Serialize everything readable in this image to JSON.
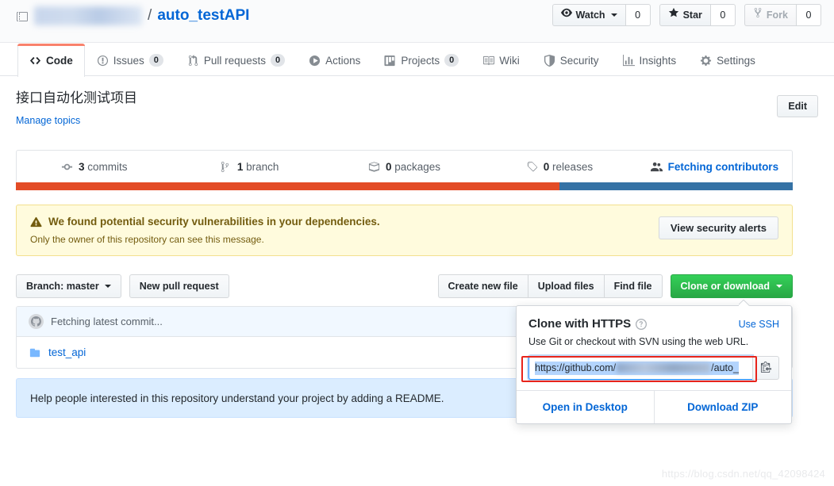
{
  "header": {
    "repo_icon": "repo-book-icon",
    "owner": "redacted-owner",
    "separator": "/",
    "name": "auto_testAPI",
    "watch": {
      "label": "Watch",
      "count": "0",
      "icon": "eye-icon"
    },
    "star": {
      "label": "Star",
      "count": "0",
      "icon": "star-icon"
    },
    "fork": {
      "label": "Fork",
      "count": "0",
      "icon": "fork-icon",
      "disabled": true
    }
  },
  "nav": {
    "items": [
      {
        "label": "Code",
        "icon": "code-icon",
        "count": "",
        "active": true
      },
      {
        "label": "Issues",
        "icon": "issue-opened-icon",
        "count": "0",
        "active": false
      },
      {
        "label": "Pull requests",
        "icon": "git-pull-request-icon",
        "count": "0",
        "active": false
      },
      {
        "label": "Actions",
        "icon": "play-icon",
        "count": "",
        "active": false
      },
      {
        "label": "Projects",
        "icon": "project-board-icon",
        "count": "0",
        "active": false
      },
      {
        "label": "Wiki",
        "icon": "book-icon",
        "count": "",
        "active": false
      },
      {
        "label": "Security",
        "icon": "shield-icon",
        "count": "",
        "active": false
      },
      {
        "label": "Insights",
        "icon": "graph-icon",
        "count": "",
        "active": false
      },
      {
        "label": "Settings",
        "icon": "gear-icon",
        "count": "",
        "active": false
      }
    ]
  },
  "about": {
    "description": "接口自动化测试项目",
    "manage_topics": "Manage topics",
    "edit_label": "Edit"
  },
  "stats": {
    "items": [
      {
        "icon": "commit-icon",
        "value": "3",
        "label": "commits"
      },
      {
        "icon": "branch-icon",
        "value": "1",
        "label": "branch"
      },
      {
        "icon": "package-icon",
        "value": "0",
        "label": "packages"
      },
      {
        "icon": "tag-icon",
        "value": "0",
        "label": "releases"
      }
    ],
    "contributors": {
      "icon": "people-icon",
      "label": "Fetching contributors"
    },
    "languages": [
      {
        "name": "language-primary",
        "color": "#e34c26",
        "percent": 70
      },
      {
        "name": "language-secondary",
        "color": "#3572A5",
        "percent": 30
      }
    ]
  },
  "alert": {
    "icon": "alert-triangle-icon",
    "title": "We found potential security vulnerabilities in your dependencies.",
    "subtitle": "Only the owner of this repository can see this message.",
    "button": "View security alerts",
    "bg_color": "#fffbdd",
    "border_color": "#f3e08e",
    "text_color": "#735c0f"
  },
  "actions": {
    "branch_label": "Branch: master",
    "new_pull_request": "New pull request",
    "create_new_file": "Create new file",
    "upload_files": "Upload files",
    "find_file": "Find file",
    "clone_or_download": "Clone or download",
    "clone_button_color": "#28a745"
  },
  "files": {
    "commit_status": "Fetching latest commit...",
    "rows": [
      {
        "icon": "folder-icon",
        "name": "test_api"
      }
    ]
  },
  "readme_prompt": {
    "text": "Help people interested in this repository understand your project by adding a README."
  },
  "clone_popover": {
    "title": "Clone with HTTPS",
    "help_icon": "question-icon",
    "use_ssh": "Use SSH",
    "description": "Use Git or checkout with SVN using the web URL.",
    "url_prefix": "https://github.com/",
    "url_suffix": "/auto_",
    "copy_icon": "clipboard-copy-icon",
    "open_in_desktop": "Open in Desktop",
    "download_zip": "Download ZIP",
    "highlight_color": "#e8241b"
  },
  "watermark": "https://blog.csdn.net/qq_42098424"
}
